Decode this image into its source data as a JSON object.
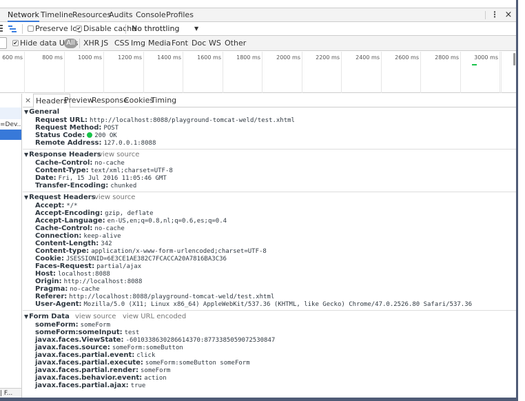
{
  "main_tabs": [
    {
      "label": "Network",
      "active": true
    },
    {
      "label": "Timeline"
    },
    {
      "label": "Resources"
    },
    {
      "label": "Audits"
    },
    {
      "label": "Console"
    },
    {
      "label": "Profiles"
    }
  ],
  "window_controls": {
    "menu_icon": "vertical-ellipsis",
    "close_icon": "×"
  },
  "toolbar": {
    "preserve_log": {
      "label": "Preserve log",
      "checked": false
    },
    "disable_cache": {
      "label": "Disable cache",
      "checked": true
    },
    "throttling": {
      "selected": "No throttling",
      "arrow": "▼"
    }
  },
  "filter": {
    "hide_data_urls": {
      "label": "Hide data URLs",
      "checked": true
    },
    "all_label": "All",
    "types": [
      "XHR",
      "JS",
      "CSS",
      "Img",
      "Media",
      "Font",
      "Doc",
      "WS",
      "Other"
    ]
  },
  "overview": {
    "ticks": [
      "600 ms",
      "800 ms",
      "1000 ms",
      "1200 ms",
      "1400 ms",
      "1600 ms",
      "1800 ms",
      "2000 ms",
      "2200 ms",
      "2400 ms",
      "2600 ms",
      "2800 ms",
      "3000 ms"
    ],
    "bar_color": "#19c34a"
  },
  "request_list": {
    "rows": [
      "",
      "=Dev...",
      ""
    ],
    "selected_color": "#3879d9",
    "footer": "| F..."
  },
  "details": {
    "close_label": "×",
    "tabs": [
      {
        "label": "Headers",
        "active": true
      },
      {
        "label": "Preview"
      },
      {
        "label": "Response"
      },
      {
        "label": "Cookies"
      },
      {
        "label": "Timing"
      }
    ],
    "general": {
      "title": "General",
      "rows": [
        {
          "key": "Request URL:",
          "value": "http://localhost:8088/playground-tomcat-weld/test.xhtml"
        },
        {
          "key": "Request Method:",
          "value": "POST"
        },
        {
          "key": "Status Code:",
          "value": "200 OK",
          "status_color": "#19c34a"
        },
        {
          "key": "Remote Address:",
          "value": "127.0.0.1:8088"
        }
      ]
    },
    "response_headers": {
      "title": "Response Headers",
      "link": "view source",
      "rows": [
        {
          "key": "Cache-Control:",
          "value": "no-cache"
        },
        {
          "key": "Content-Type:",
          "value": "text/xml;charset=UTF-8"
        },
        {
          "key": "Date:",
          "value": "Fri, 15 Jul 2016 11:05:46 GMT"
        },
        {
          "key": "Transfer-Encoding:",
          "value": "chunked"
        }
      ]
    },
    "request_headers": {
      "title": "Request Headers",
      "link": "view source",
      "rows": [
        {
          "key": "Accept:",
          "value": "*/*"
        },
        {
          "key": "Accept-Encoding:",
          "value": "gzip, deflate"
        },
        {
          "key": "Accept-Language:",
          "value": "en-US,en;q=0.8,nl;q=0.6,es;q=0.4"
        },
        {
          "key": "Cache-Control:",
          "value": "no-cache"
        },
        {
          "key": "Connection:",
          "value": "keep-alive"
        },
        {
          "key": "Content-Length:",
          "value": "342"
        },
        {
          "key": "Content-type:",
          "value": "application/x-www-form-urlencoded;charset=UTF-8"
        },
        {
          "key": "Cookie:",
          "value": "JSESSIONID=6E3CE1AE382C7FCACCA20A7816BA3C36"
        },
        {
          "key": "Faces-Request:",
          "value": "partial/ajax"
        },
        {
          "key": "Host:",
          "value": "localhost:8088"
        },
        {
          "key": "Origin:",
          "value": "http://localhost:8088"
        },
        {
          "key": "Pragma:",
          "value": "no-cache"
        },
        {
          "key": "Referer:",
          "value": "http://localhost:8088/playground-tomcat-weld/test.xhtml"
        },
        {
          "key": "User-Agent:",
          "value": "Mozilla/5.0 (X11; Linux x86_64) AppleWebKit/537.36 (KHTML, like Gecko) Chrome/47.0.2526.80 Safari/537.36"
        }
      ]
    },
    "form_data": {
      "title": "Form Data",
      "link": "view source",
      "link2": "view URL encoded",
      "rows": [
        {
          "key": "someForm:",
          "value": "someForm"
        },
        {
          "key": "someForm:someInput:",
          "value": "test"
        },
        {
          "key": "javax.faces.ViewState:",
          "value": "-6010338630286614370:8773385059072530847"
        },
        {
          "key": "javax.faces.source:",
          "value": "someForm:someButton"
        },
        {
          "key": "javax.faces.partial.event:",
          "value": "click"
        },
        {
          "key": "javax.faces.partial.execute:",
          "value": "someForm:someButton someForm"
        },
        {
          "key": "javax.faces.partial.render:",
          "value": "someForm"
        },
        {
          "key": "javax.faces.behavior.event:",
          "value": "action"
        },
        {
          "key": "javax.faces.partial.ajax:",
          "value": "true"
        }
      ]
    }
  }
}
